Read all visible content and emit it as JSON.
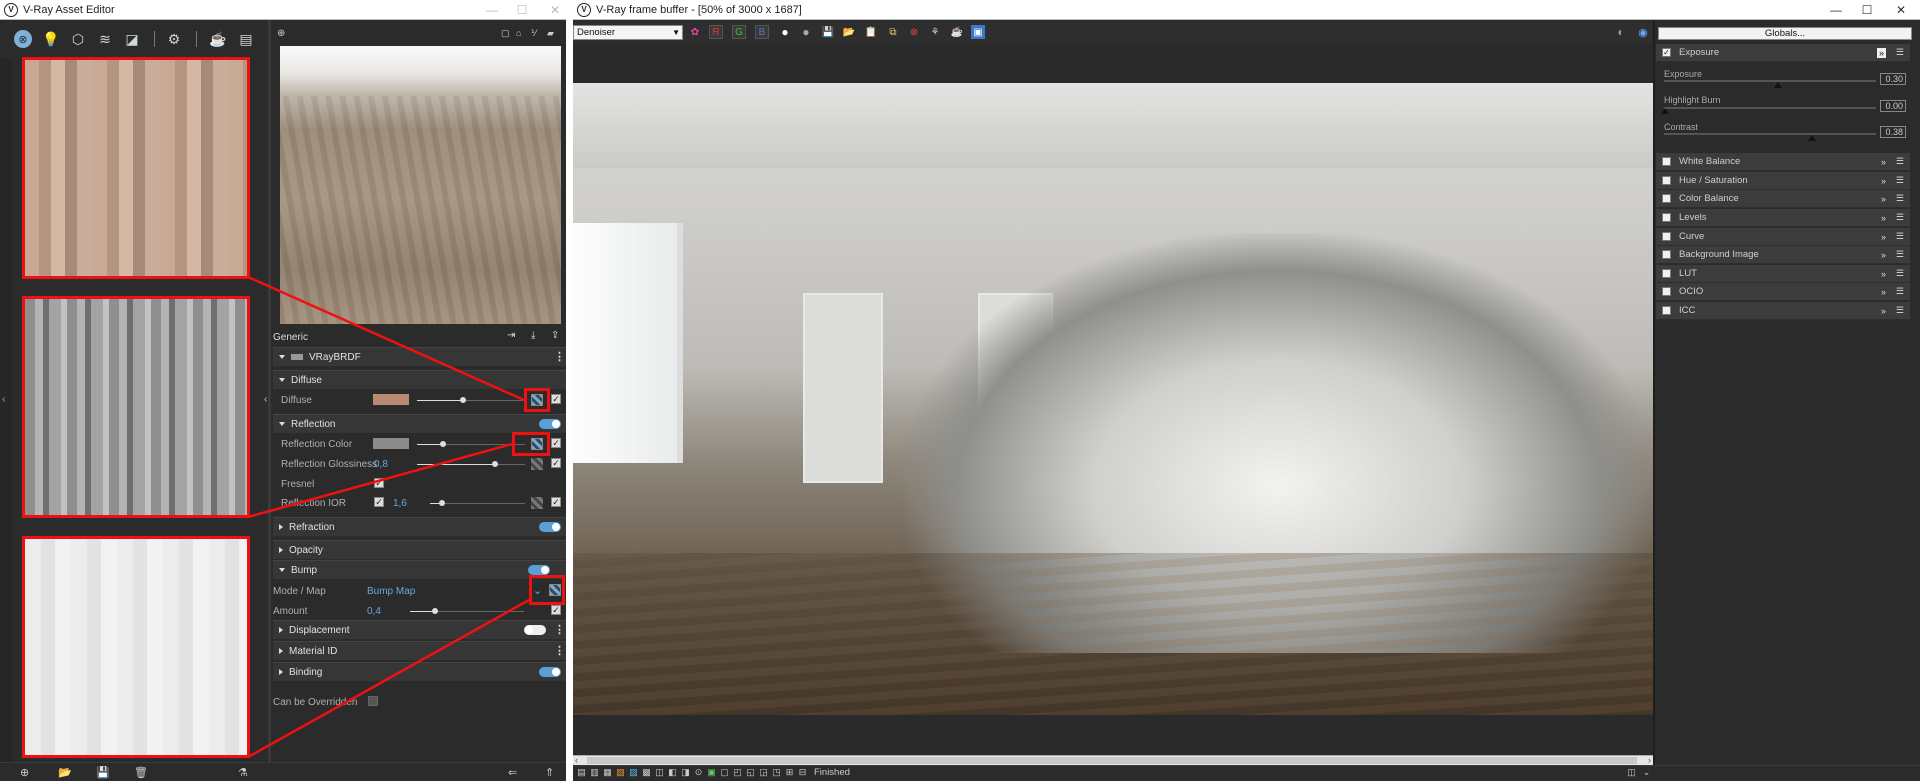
{
  "asset_editor": {
    "title": "V-Ray Asset Editor",
    "generic_label": "Generic",
    "material_name": "VRayBRDF",
    "sections": {
      "diffuse": "Diffuse",
      "reflection": "Reflection",
      "refraction": "Refraction",
      "opacity": "Opacity",
      "bump": "Bump",
      "displacement": "Displacement",
      "material_id": "Material ID",
      "binding": "Binding"
    },
    "params": {
      "diffuse_label": "Diffuse",
      "diffuse_color": "#b98a72",
      "reflection_color_label": "Reflection Color",
      "reflection_color": "#8c8c8c",
      "reflection_glossiness_label": "Reflection Glossiness",
      "reflection_glossiness_value": "0,8",
      "fresnel_label": "Fresnel",
      "reflection_ior_label": "Reflection IOR",
      "reflection_ior_value": "1,6",
      "mode_map_label": "Mode / Map",
      "mode_map_value": "Bump Map",
      "amount_label": "Amount",
      "amount_value": "0,4",
      "can_be_overridden_label": "Can be Overridden"
    }
  },
  "frame_buffer": {
    "title": "V-Ray frame buffer - [50% of 3000 x 1687]",
    "dropdown_value": "Denoiser",
    "channel_r": "R",
    "channel_g": "G",
    "channel_b": "B",
    "status_text": "Finished"
  },
  "color_corrections": {
    "globals_button": "Globals...",
    "exposure_section": "Exposure",
    "exposure_label": "Exposure",
    "exposure_value": "0.30",
    "highlight_burn_label": "Highlight Burn",
    "highlight_burn_value": "0.00",
    "contrast_label": "Contrast",
    "contrast_value": "0.38",
    "layers": [
      "White Balance",
      "Hue / Saturation",
      "Color Balance",
      "Levels",
      "Curve",
      "Background Image",
      "LUT",
      "OCIO",
      "ICC"
    ]
  },
  "colors": {
    "accent_blue": "#5aa0d6",
    "highlight_red": "#e11111"
  }
}
